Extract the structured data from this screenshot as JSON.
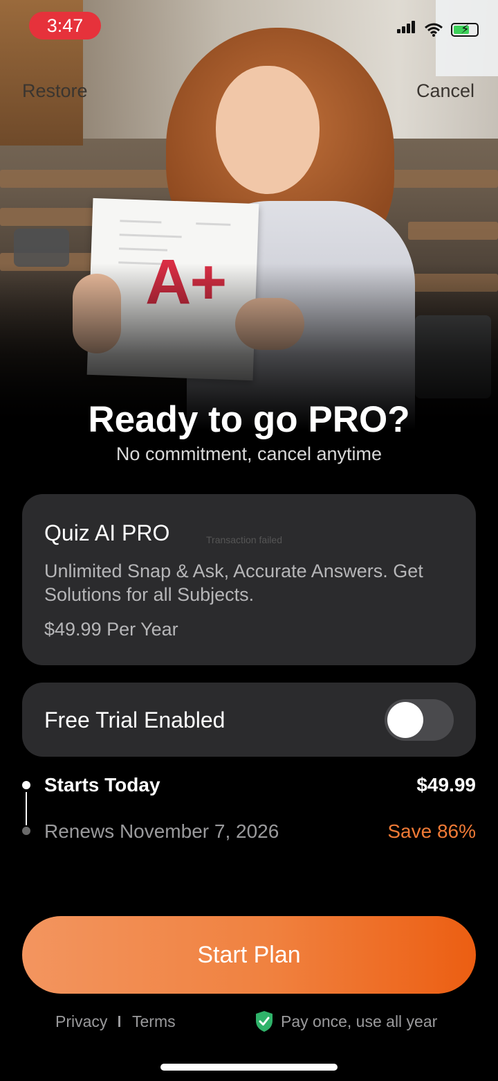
{
  "status_bar": {
    "time": "3:47"
  },
  "nav": {
    "restore": "Restore",
    "cancel": "Cancel"
  },
  "hero": {
    "grade_text": "A+"
  },
  "headline": "Ready to go PRO?",
  "subheadline": "No commitment, cancel anytime",
  "plan": {
    "title": "Quiz AI PRO",
    "overlay_text": "Transaction failed",
    "description": "Unlimited Snap & Ask, Accurate Answers. Get Solutions for all Subjects.",
    "price": "$49.99 Per Year"
  },
  "trial": {
    "label": "Free Trial Enabled",
    "enabled": false
  },
  "timeline": {
    "starts_label": "Starts Today",
    "starts_price": "$49.99",
    "renews_label": "Renews November 7, 2026",
    "save_label": "Save 86%"
  },
  "cta": {
    "label": "Start Plan"
  },
  "footer": {
    "privacy": "Privacy",
    "terms": "Terms",
    "pay_once": "Pay once, use all year"
  },
  "colors": {
    "accent": "#f0813f",
    "save": "#f07a36",
    "card": "#2b2b2d",
    "time_pill": "#e6323b"
  }
}
